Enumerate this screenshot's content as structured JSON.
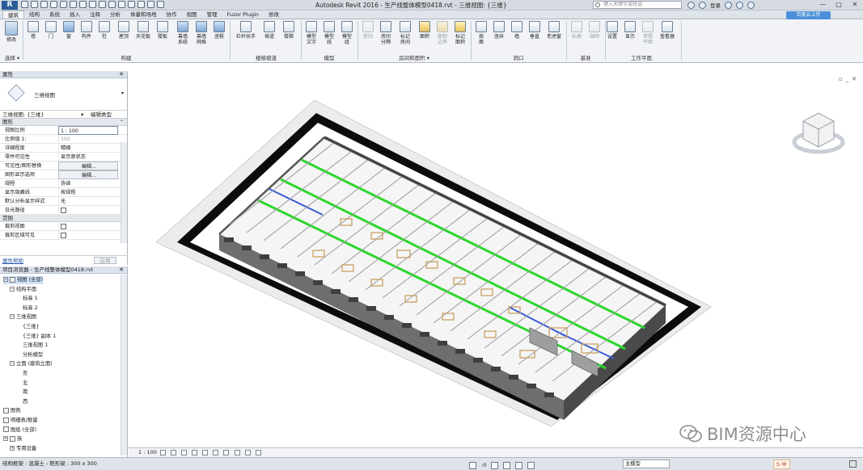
{
  "app": {
    "logo": "R",
    "window_title": "Autodesk Revit 2016 -   生产线整体模型0418.rvt - 三维视图: {三维}",
    "search_placeholder": "键入关键字或短语",
    "login_label": "登录",
    "window_controls": [
      "—",
      "□",
      "✕"
    ]
  },
  "ribbon": {
    "tabs": [
      "建筑",
      "结构",
      "系统",
      "插入",
      "注释",
      "分析",
      "体量和场地",
      "协作",
      "视图",
      "管理",
      "Fuzor Plugin",
      "修改"
    ],
    "active_tab": "建筑",
    "upload_label": "百度云上传",
    "modify_label": "修改",
    "select_label": "选择 ▾",
    "groups": {
      "build": {
        "label": "构建",
        "buttons": [
          "墙",
          "门",
          "窗",
          "构件",
          "柱",
          "屋顶",
          "天花板",
          "楼板",
          "幕墙\n系统",
          "幕墙\n网格",
          "竖梃"
        ]
      },
      "circulation": {
        "label": "楼梯坡道",
        "buttons": [
          "栏杆扶手",
          "坡道",
          "楼梯"
        ]
      },
      "model": {
        "label": "模型",
        "buttons": [
          "模型\n文字",
          "模型\n线",
          "模型\n组"
        ]
      },
      "room": {
        "label": "房间和面积 ▾",
        "buttons": [
          "房间",
          "房间\n分隔",
          "标记\n房间",
          "面积",
          "面积\n边界",
          "标记\n面积"
        ]
      },
      "opening": {
        "label": "洞口",
        "buttons": [
          "按\n面",
          "竖井",
          "墙",
          "垂直",
          "老虎窗"
        ]
      },
      "datum": {
        "label": "基准",
        "buttons": [
          "标高",
          "轴网"
        ]
      },
      "workplane": {
        "label": "工作平面",
        "buttons": [
          "设置",
          "显示",
          "参照\n平面",
          "查看器"
        ]
      }
    }
  },
  "properties": {
    "title": "属性",
    "close": "✕",
    "type_name": "三维视图",
    "instance_selector": "三维视图: {三维}",
    "edit_type": "编辑类型",
    "categories": {
      "graphics": "图形",
      "extents": "范围"
    },
    "rows": [
      {
        "name": "视图比例",
        "value": "1 : 100",
        "kind": "input"
      },
      {
        "name": "比例值 1:",
        "value": "100",
        "kind": "grey"
      },
      {
        "name": "详细程度",
        "value": "精细",
        "kind": "text"
      },
      {
        "name": "零件可见性",
        "value": "显示原状态",
        "kind": "text"
      },
      {
        "name": "可见性/图形替换",
        "value": "编辑...",
        "kind": "btn"
      },
      {
        "name": "图形显示选项",
        "value": "编辑...",
        "kind": "btn"
      },
      {
        "name": "规程",
        "value": "协调",
        "kind": "text"
      },
      {
        "name": "显示隐藏线",
        "value": "按规程",
        "kind": "text"
      },
      {
        "name": "默认分析显示样式",
        "value": "无",
        "kind": "text"
      },
      {
        "name": "日光路径",
        "value": "",
        "kind": "check"
      }
    ],
    "extent_rows": [
      {
        "name": "裁剪视图",
        "value": "",
        "kind": "check"
      },
      {
        "name": "裁剪区域可见",
        "value": "",
        "kind": "check"
      }
    ],
    "help_link": "属性帮助",
    "apply_label": "应用"
  },
  "browser": {
    "title": "项目浏览器 - 生产线整体模型0418.rvt",
    "items": [
      {
        "label": "视图 (全部)",
        "indent": 0,
        "exp": "−",
        "icon": true
      },
      {
        "label": "结构平面",
        "indent": 1,
        "exp": "−"
      },
      {
        "label": "标高 1",
        "indent": 3
      },
      {
        "label": "标高 2",
        "indent": 3
      },
      {
        "label": "三维视图",
        "indent": 1,
        "exp": "−"
      },
      {
        "label": "{三维}",
        "indent": 3
      },
      {
        "label": "{三维} 副本 1",
        "indent": 3
      },
      {
        "label": "三维视图 1",
        "indent": 3
      },
      {
        "label": "分析模型",
        "indent": 3
      },
      {
        "label": "立面 (建筑立面)",
        "indent": 1,
        "exp": "−"
      },
      {
        "label": "东",
        "indent": 3
      },
      {
        "label": "北",
        "indent": 3
      },
      {
        "label": "南",
        "indent": 3
      },
      {
        "label": "西",
        "indent": 3
      },
      {
        "label": "图例",
        "indent": 0,
        "icon": true
      },
      {
        "label": "明细表/数量",
        "indent": 0,
        "icon": true
      },
      {
        "label": "图纸 (全部)",
        "indent": 0,
        "icon": true
      },
      {
        "label": "族",
        "indent": 0,
        "exp": "+",
        "icon": true
      },
      {
        "label": "专用设备",
        "indent": 1,
        "exp": "+"
      }
    ]
  },
  "viewport": {
    "scale_label": "1 : 100"
  },
  "status": {
    "hint": "结构框架 : 混凝土 - 矩形梁 : 300 x 300",
    "model_field": "主模型",
    "zero": ":0",
    "ime_label": "S 中"
  },
  "watermark": {
    "text": "BIM资源中心"
  }
}
